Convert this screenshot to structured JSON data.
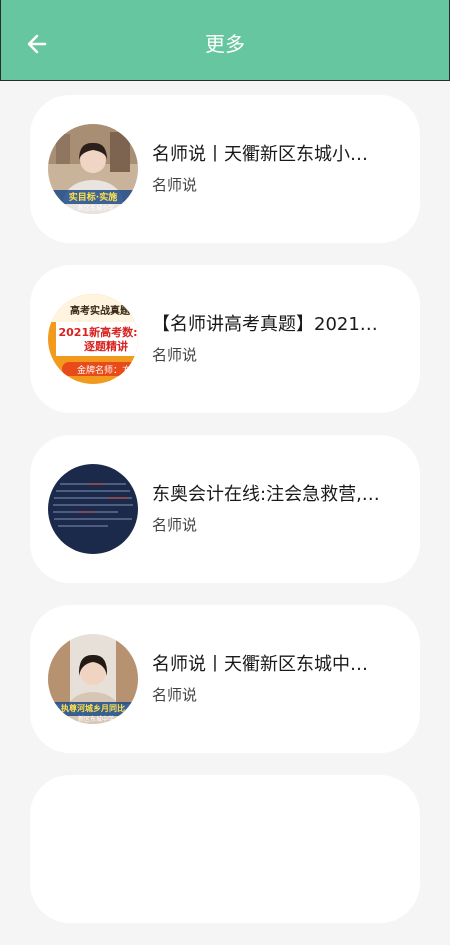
{
  "header": {
    "title": "更多",
    "back_icon": "arrow-left-icon",
    "background": "#66c6a0"
  },
  "items": [
    {
      "title": "名师说丨天衢新区东城小…",
      "subtitle": "名师说",
      "thumb_overlay": "实目标·实施",
      "thumb_caption": "新区东城小学"
    },
    {
      "title": "【名师讲高考真题】2021…",
      "subtitle": "名师说",
      "thumb_top": "高考实战真题",
      "thumb_mid": "2021新高考数:",
      "thumb_mid2": "逐题精讲",
      "thumb_bottom": "金牌名师：方"
    },
    {
      "title": "东奥会计在线:注会急救营,…",
      "subtitle": "名师说"
    },
    {
      "title": "名师说丨天衢新区东城中…",
      "subtitle": "名师说",
      "thumb_overlay": "执尊河城乡月同比",
      "thumb_caption": "新区东城中学"
    }
  ]
}
